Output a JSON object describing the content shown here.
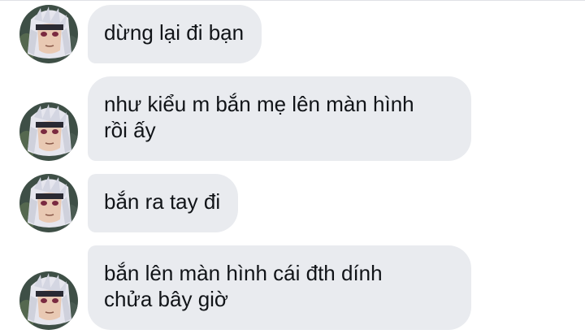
{
  "conversation": {
    "messages": [
      {
        "text": "dừng lại đi bạn",
        "avatar_icon": "user-avatar"
      },
      {
        "text": "như kiểu m bắn mẹ lên màn hình\nrồi ấy",
        "avatar_icon": "user-avatar"
      },
      {
        "text": "bắn ra tay đi",
        "avatar_icon": "user-avatar"
      },
      {
        "text": "bắn lên màn hình cái đth dính\nchửa bây giờ",
        "avatar_icon": "user-avatar"
      }
    ]
  },
  "colors": {
    "bubble_bg": "#e9ebef",
    "text": "#111418",
    "background": "#ffffff"
  }
}
